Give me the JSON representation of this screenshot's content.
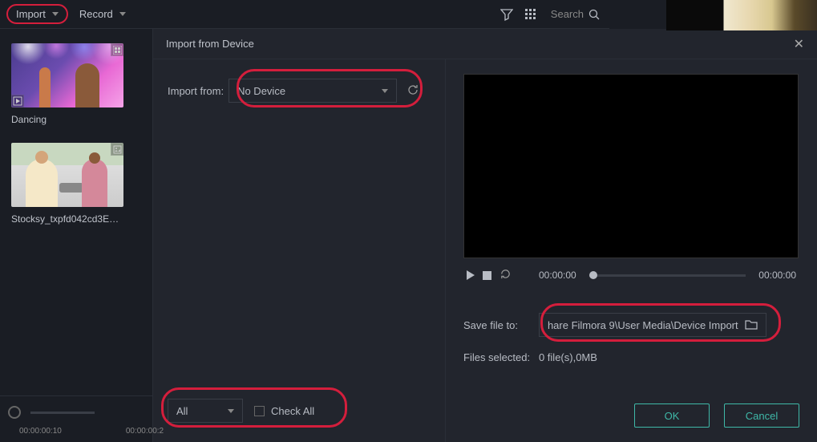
{
  "topbar": {
    "import_label": "Import",
    "record_label": "Record",
    "search_placeholder": "Search"
  },
  "sidebar": {
    "items": [
      {
        "label": "Dancing"
      },
      {
        "label": "Stocksy_txpfd042cd3EA..."
      }
    ]
  },
  "dialog": {
    "title": "Import from Device",
    "import_from_label": "Import from:",
    "device_select": "No Device",
    "filter_select": "All",
    "check_all_label": "Check All",
    "time_start": "00:00:00",
    "time_end": "00:00:00",
    "save_label": "Save file to:",
    "save_path": "hare Filmora 9\\User Media\\Device Import",
    "files_selected_label": "Files selected:",
    "files_selected_value": "0 file(s),0MB",
    "ok_label": "OK",
    "cancel_label": "Cancel"
  },
  "timeline": {
    "t1": "00:00:00:10",
    "t2": "00:00:00:2"
  }
}
